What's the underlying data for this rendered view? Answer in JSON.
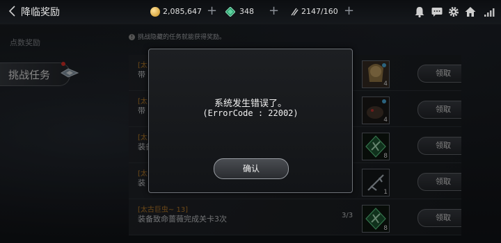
{
  "header": {
    "title": "降临奖励",
    "gold": "2,085,647",
    "gems": "348",
    "stamina": "2147/160"
  },
  "sidebar": {
    "label": "点数奖励",
    "tab": "挑战任务"
  },
  "notice": "挑战隐藏的任务就能获得奖励。",
  "rows": [
    {
      "tag": "[太",
      "desc": "带",
      "progress": "",
      "reward_count": "4",
      "claim": "领取"
    },
    {
      "tag": "[太",
      "desc": "带",
      "progress": "",
      "reward_count": "4",
      "claim": "领取"
    },
    {
      "tag": "[太",
      "desc": "装备",
      "progress": "",
      "reward_count": "8",
      "claim": "领取"
    },
    {
      "tag": "[太",
      "desc": "装",
      "progress": "",
      "reward_count": "1",
      "claim": "领取"
    },
    {
      "tag": "[太古巨虫~ 13]",
      "desc": "装备致命蔷薇完成关卡3次",
      "progress": "3/3",
      "reward_count": "8",
      "claim": "领取"
    }
  ],
  "dialog": {
    "message": "系统发生错误了。",
    "code": "(ErrorCode : 22002)",
    "confirm": "确认"
  },
  "colors": {
    "accent": "#c7852b",
    "alert": "#e5322b",
    "gem": "#3fbf86"
  }
}
